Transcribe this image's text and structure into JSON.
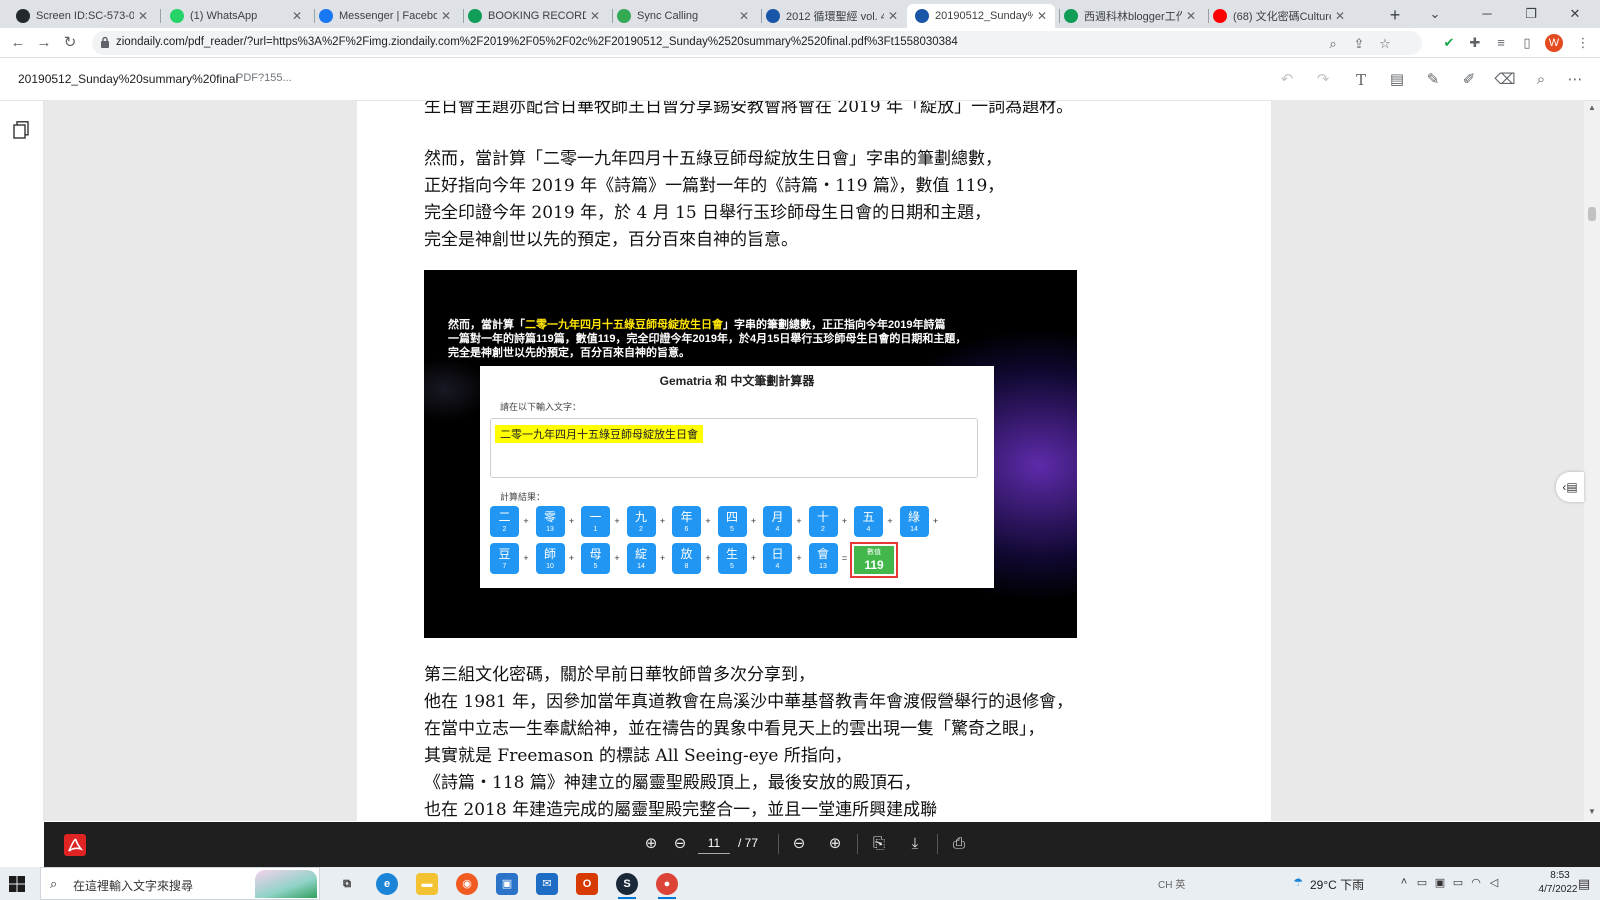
{
  "browser": {
    "tabs": [
      {
        "label": "Screen ID:SC-573-00",
        "icon": "github-icon",
        "color": "#24292e"
      },
      {
        "label": "(1) WhatsApp",
        "icon": "whatsapp-icon",
        "color": "#25d366"
      },
      {
        "label": "Messenger | Faceboo",
        "icon": "facebook-icon",
        "color": "#1877f2"
      },
      {
        "label": "BOOKING RECORD -",
        "icon": "sheets-icon",
        "color": "#0f9d58"
      },
      {
        "label": "Sync Calling",
        "icon": "sync-icon",
        "color": "#34a853"
      },
      {
        "label": "2012 循環聖經 vol. 48",
        "icon": "zoo-icon",
        "color": "#1a56a8"
      },
      {
        "label": "20190512_Sunday%",
        "icon": "zoo-icon",
        "color": "#1a56a8",
        "active": true
      },
      {
        "label": "西週科林blogger工作",
        "icon": "sheets-icon",
        "color": "#0f9d58"
      },
      {
        "label": "(68) 文化密碼Culture",
        "icon": "youtube-icon",
        "color": "#ff0000"
      }
    ],
    "url": "ziondaily.com/pdf_reader/?url=https%3A%2F%2Fimg.ziondaily.com%2F2019%2F05%2F02c%2F20190512_Sunday%2520summary%2520final.pdf%3Ft1558030384",
    "profile_initial": "W"
  },
  "pdf_header": {
    "title": "20190512_Sunday%20summary%20final",
    "subtitle": "PDF?155..."
  },
  "page_text": {
    "line_top": "生日會主題亦配合日華牧師王日曾分享錫安教會將會在 2019 年「綻放」一詞為題材。",
    "para1": [
      "然而，當計算「二零一九年四月十五綠豆師母綻放生日會」字串的筆劃總數，",
      "正好指向今年 2019 年《詩篇》一篇對一年的《詩篇・119 篇》，數值 119，",
      "完全印證今年 2019 年，於 4 月 15 日舉行玉珍師母生日會的日期和主題，",
      "完全是神創世以先的預定，百分百來自神的旨意。"
    ],
    "para2": [
      "第三組文化密碼，關於早前日華牧師曾多次分享到，",
      "他在 1981 年，因參加當年真道教會在烏溪沙中華基督教青年會渡假營舉行的退修會，",
      "在當中立志一生奉獻給神，並在禱告的異象中看見天上的雲出現一隻「驚奇之眼」，",
      "其實就是 Freemason 的標誌 All Seeing-eye 所指向，",
      "《詩篇・118 篇》神建立的屬靈聖殿殿頂上，最後安放的殿頂石，",
      "也在 2018 年建造完成的屬靈聖殿完整合一，並且一堂連所興建成聯"
    ]
  },
  "slide": {
    "line1_pre": "然而，當計算「",
    "line1_hl": "二零一九年四月十五綠豆師母綻放生日會",
    "line1_post": "」字串的筆劃總數，正正指向今年2019年詩篇",
    "line2": "一篇對一年的詩篇119篇，數值119，完全印證今年2019年，於4月15日舉行玉珍師母生日會的日期和主題，",
    "line3": "完全是神創世以先的預定，百分百來自神的旨意。",
    "calc_title": "Gematria 和 中文筆劃計算器",
    "prompt": "請在以下輸入文字：",
    "input_text": "二零一九年四月十五綠豆師母綻放生日會",
    "result_label": "計算結果：",
    "row1": [
      [
        "二",
        "2"
      ],
      [
        "零",
        "13"
      ],
      [
        "一",
        "1"
      ],
      [
        "九",
        "2"
      ],
      [
        "年",
        "6"
      ],
      [
        "四",
        "5"
      ],
      [
        "月",
        "4"
      ],
      [
        "十",
        "2"
      ],
      [
        "五",
        "4"
      ],
      [
        "綠",
        "14"
      ]
    ],
    "row2": [
      [
        "豆",
        "7"
      ],
      [
        "師",
        "10"
      ],
      [
        "母",
        "5"
      ],
      [
        "綻",
        "14"
      ],
      [
        "放",
        "8"
      ],
      [
        "生",
        "5"
      ],
      [
        "日",
        "4"
      ],
      [
        "會",
        "13"
      ]
    ],
    "total_label": "數值",
    "total_value": "119"
  },
  "pdf_bottom": {
    "page_current": "11",
    "page_total": "/ 77"
  },
  "taskbar": {
    "search_placeholder": "在這裡輸入文字來搜尋",
    "weather": "29°C  下雨",
    "ime": "CH 英",
    "time": "8:53",
    "date": "4/7/2022"
  }
}
